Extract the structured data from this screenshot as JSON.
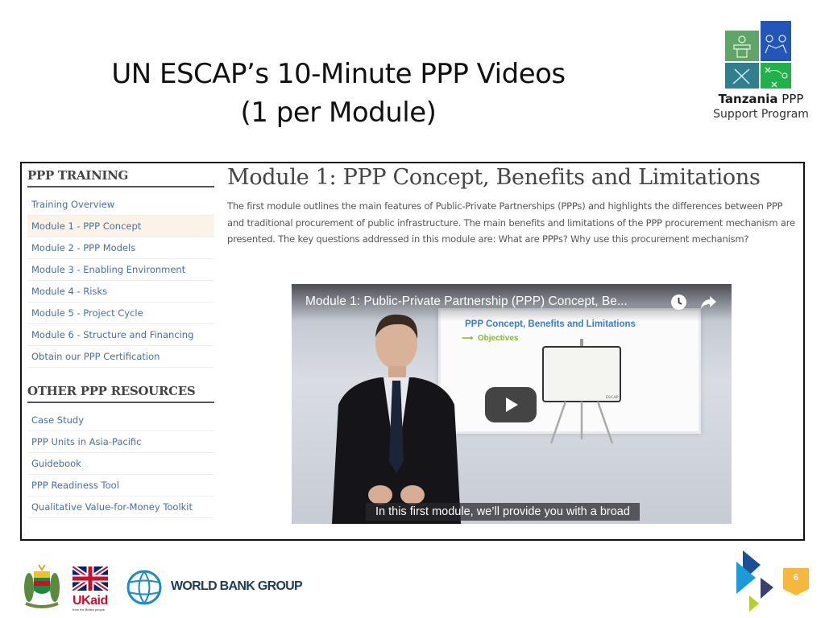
{
  "slide": {
    "title_line1": "UN ESCAP’s 10-Minute PPP Videos",
    "title_line2": "(1 per Module)",
    "page_number": "6"
  },
  "logo": {
    "name_bold": "Tanzania",
    "name_rest": " PPP",
    "subtitle": "Support Program",
    "colors": [
      "#5ea567",
      "#2356b8",
      "#2f7f8f",
      "#22b04a"
    ]
  },
  "sidebar": {
    "training_heading": "PPP TRAINING",
    "training_items": [
      {
        "label": "Training Overview",
        "active": false
      },
      {
        "label": "Module 1 - PPP Concept",
        "active": true
      },
      {
        "label": "Module 2 - PPP Models",
        "active": false
      },
      {
        "label": "Module 3 - Enabling Environment",
        "active": false
      },
      {
        "label": "Module 4 - Risks",
        "active": false
      },
      {
        "label": "Module 5 - Project Cycle",
        "active": false
      },
      {
        "label": "Module 6 - Structure and Financing",
        "active": false
      },
      {
        "label": "Obtain our PPP Certification",
        "active": false
      }
    ],
    "resources_heading": "OTHER PPP RESOURCES",
    "resource_items": [
      {
        "label": "Case Study"
      },
      {
        "label": "PPP Units in Asia-Pacific"
      },
      {
        "label": "Guidebook"
      },
      {
        "label": "PPP Readiness Tool"
      },
      {
        "label": "Qualitative Value-for-Money Toolkit"
      }
    ]
  },
  "main": {
    "title": "Module 1: PPP Concept, Benefits and Limitations",
    "description": "The first module outlines the main features of Public-Private Partnerships (PPPs) and highlights the differences between PPP and traditional procurement of public infrastructure. The main benefits and limitations of the PPP procurement mechanism are presented. The key questions addressed in this module are: What are PPPs? Why use this procurement mechanism?"
  },
  "video": {
    "title": "Module 1: Public-Private Partnership (PPP) Concept, Be...",
    "board_title": "PPP Concept, Benefits and Limitations",
    "board_objective": "Objectives",
    "easel_label": "ESCAP",
    "caption": "In this first module, we’ll provide you with a broad",
    "icons": {
      "watch_later": "clock-icon",
      "share": "share-icon",
      "play": "play-icon"
    }
  },
  "footer": {
    "ukaid_text_uk": "UK",
    "ukaid_text_aid": "aid",
    "ukaid_sub": "from the British people",
    "worldbank": "WORLD BANK GROUP"
  }
}
